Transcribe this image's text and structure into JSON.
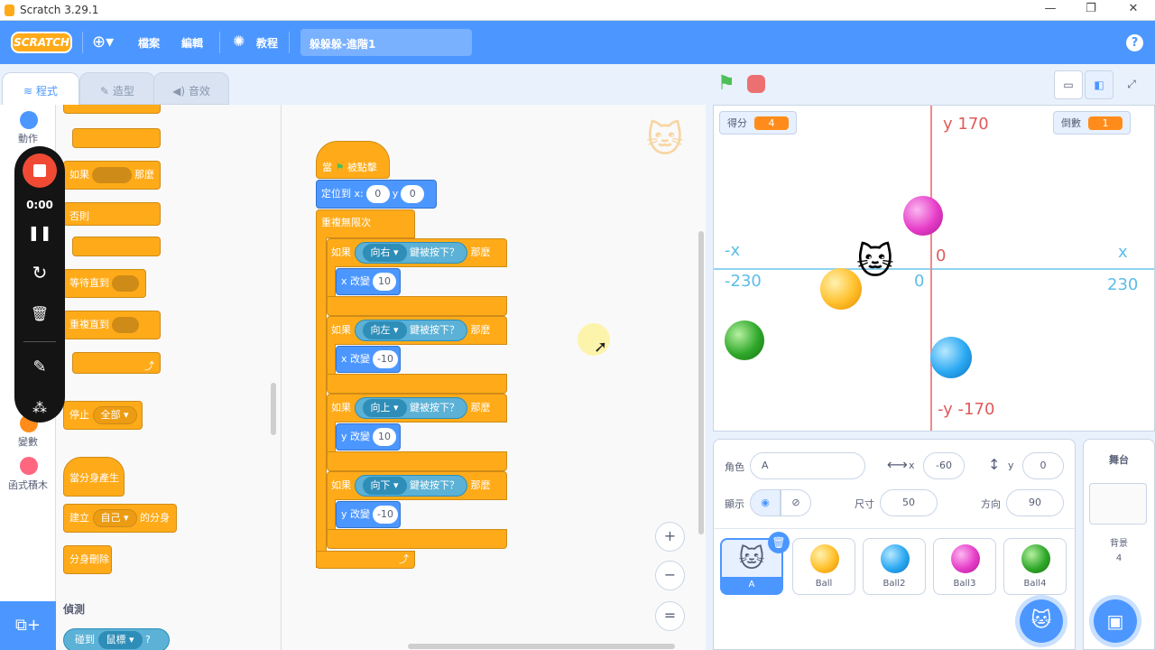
{
  "window": {
    "title": "Scratch 3.29.1"
  },
  "menu": {
    "logo": "SCRATCH",
    "file": "檔案",
    "edit": "編輯",
    "tutorial": "教程",
    "project_name": "躲躲躲-進階1"
  },
  "tabs": {
    "code": "程式",
    "costumes": "造型",
    "sounds": "音效"
  },
  "categories": {
    "motion": "動作",
    "variables": "變數",
    "myblocks": "函式積木"
  },
  "palette": {
    "if_then": "如果",
    "then": "那麼",
    "else": "否則",
    "wait_until": "等待直到",
    "repeat_until": "重複直到",
    "stop": "停止",
    "stop_opt": "全部",
    "when_clone": "當分身產生",
    "create_clone": "建立",
    "clone_of": "的分身",
    "clone_self": "自己",
    "delete_clone": "分身刪除",
    "sensing_title": "偵測",
    "touching": "碰到",
    "mouse": "鼠標",
    "q": "?"
  },
  "script": {
    "when_flag": "當",
    "clicked": "被點擊",
    "goto": "定位到 x:",
    "x0": "0",
    "ylbl": "y",
    "y0": "0",
    "forever": "重複無限次",
    "ifs": [
      {
        "if": "如果",
        "key": "向右",
        "pressed": "鍵被按下？",
        "then": "那麼",
        "change": "x 改變",
        "val": "10"
      },
      {
        "if": "如果",
        "key": "向左",
        "pressed": "鍵被按下？",
        "then": "那麼",
        "change": "x 改變",
        "val": "-10"
      },
      {
        "if": "如果",
        "key": "向上",
        "pressed": "鍵被按下？",
        "then": "那麼",
        "change": "y 改變",
        "val": "10"
      },
      {
        "if": "如果",
        "key": "向下",
        "pressed": "鍵被按下？",
        "then": "那麼",
        "change": "y 改變",
        "val": "-10"
      }
    ]
  },
  "recorder": {
    "time": "0:00"
  },
  "stage": {
    "score_label": "得分",
    "score": "4",
    "timer_label": "倒數",
    "timer": "1",
    "axis": {
      "ytop": "y  170",
      "ybot": "-y  -170",
      "xleft": "-x",
      "xleftv": "-230",
      "xright": "x",
      "xrightv": "230",
      "zero1": "0",
      "zero2": "0"
    }
  },
  "sprite": {
    "label": "角色",
    "name": "A",
    "x_lbl": "x",
    "x": "-60",
    "y_lbl": "y",
    "y": "0",
    "show": "顯示",
    "size_lbl": "尺寸",
    "size": "50",
    "dir_lbl": "方向",
    "dir": "90"
  },
  "sprites": [
    {
      "name": "A"
    },
    {
      "name": "Ball",
      "color": "#ffbf2a"
    },
    {
      "name": "Ball2",
      "color": "#2aa8f2"
    },
    {
      "name": "Ball3",
      "color": "#e63cc8"
    },
    {
      "name": "Ball4",
      "color": "#2fa82a"
    }
  ],
  "stagepane": {
    "title": "舞台",
    "backdrops_lbl": "背景",
    "backdrops": "4"
  },
  "zoom": {
    "in": "+",
    "out": "−",
    "reset": "="
  }
}
